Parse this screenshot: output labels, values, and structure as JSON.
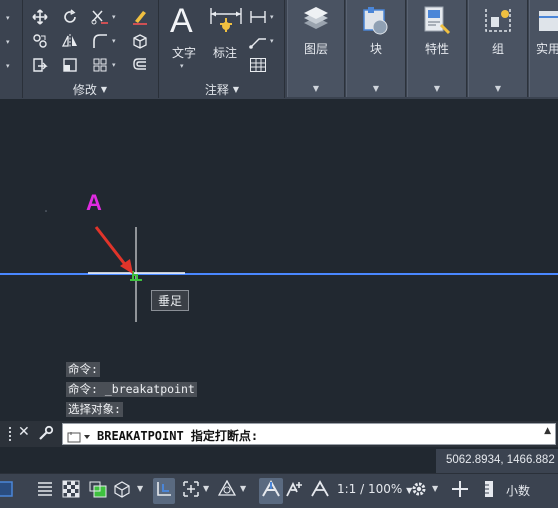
{
  "ribbon": {
    "modify_panel": {
      "label": "修改"
    },
    "annotation_panel": {
      "label": "注释",
      "text_label": "文字",
      "dim_label": "标注"
    },
    "layers_button": {
      "label": "图层"
    },
    "block_button": {
      "label": "块"
    },
    "properties_button": {
      "label": "特性"
    },
    "group_button": {
      "label": "组"
    },
    "utilities_button": {
      "label": "实用"
    }
  },
  "canvas": {
    "marker_label": "A",
    "osnap_tooltip": "垂足",
    "colors": {
      "background": "#212830",
      "line": "#4a88ff",
      "arrow": "#e0342a",
      "marker": "#e02be0",
      "snap": "#3ec13e"
    }
  },
  "command_history": [
    "命令:",
    "命令: _breakatpoint",
    "选择对象:"
  ],
  "command_line": {
    "prompt": "BREAKATPOINT 指定打断点:"
  },
  "status": {
    "coordinates": "5062.8934, 1466.882",
    "annotation_scale": "1:1 / 100%",
    "units": "小数"
  }
}
